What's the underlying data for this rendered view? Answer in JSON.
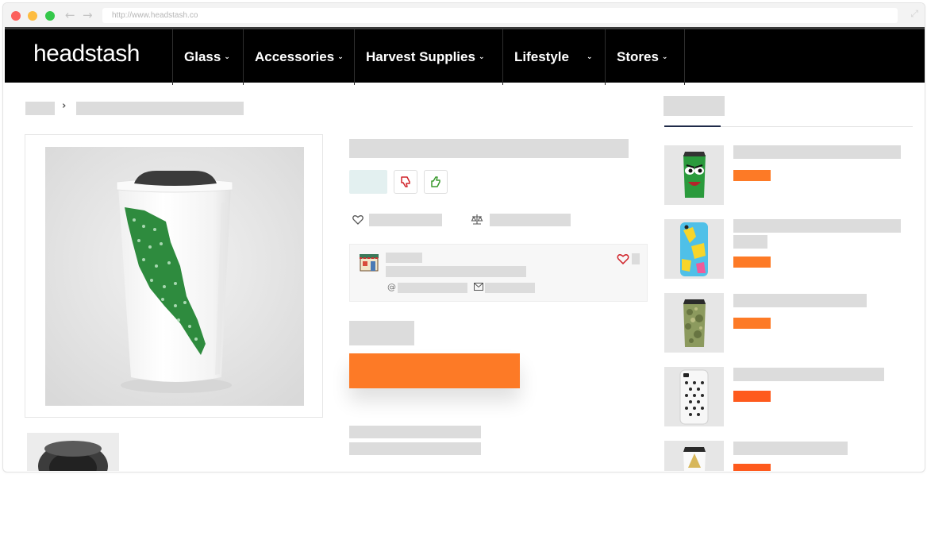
{
  "browser": {
    "url": "http://www.headstash.co",
    "back_icon": "←",
    "forward_icon": "→",
    "expand_icon": "⤢"
  },
  "site": {
    "logo": "headstash",
    "menu": [
      {
        "label": "Glass"
      },
      {
        "label": "Accessories"
      },
      {
        "label": "Harvest Supplies"
      },
      {
        "label": "Lifestyle"
      },
      {
        "label": "Stores"
      }
    ],
    "chevron": "⌄"
  },
  "breadcrumb": {
    "separator": "›"
  },
  "colors": {
    "accent": "#fd7a26",
    "price_alt": "#fe5a1d",
    "nav_bg": "#000000",
    "placeholder": "#dcdcdc",
    "tab_active": "#1f2a48",
    "vote_bg": "#e3f0f0"
  },
  "icons": {
    "dislike": "thumbs-down-icon",
    "like": "thumbs-up-icon",
    "wishlist": "heart-icon",
    "compare": "scale-icon",
    "store": "store-icon",
    "at": "@",
    "mail": "envelope-icon"
  }
}
